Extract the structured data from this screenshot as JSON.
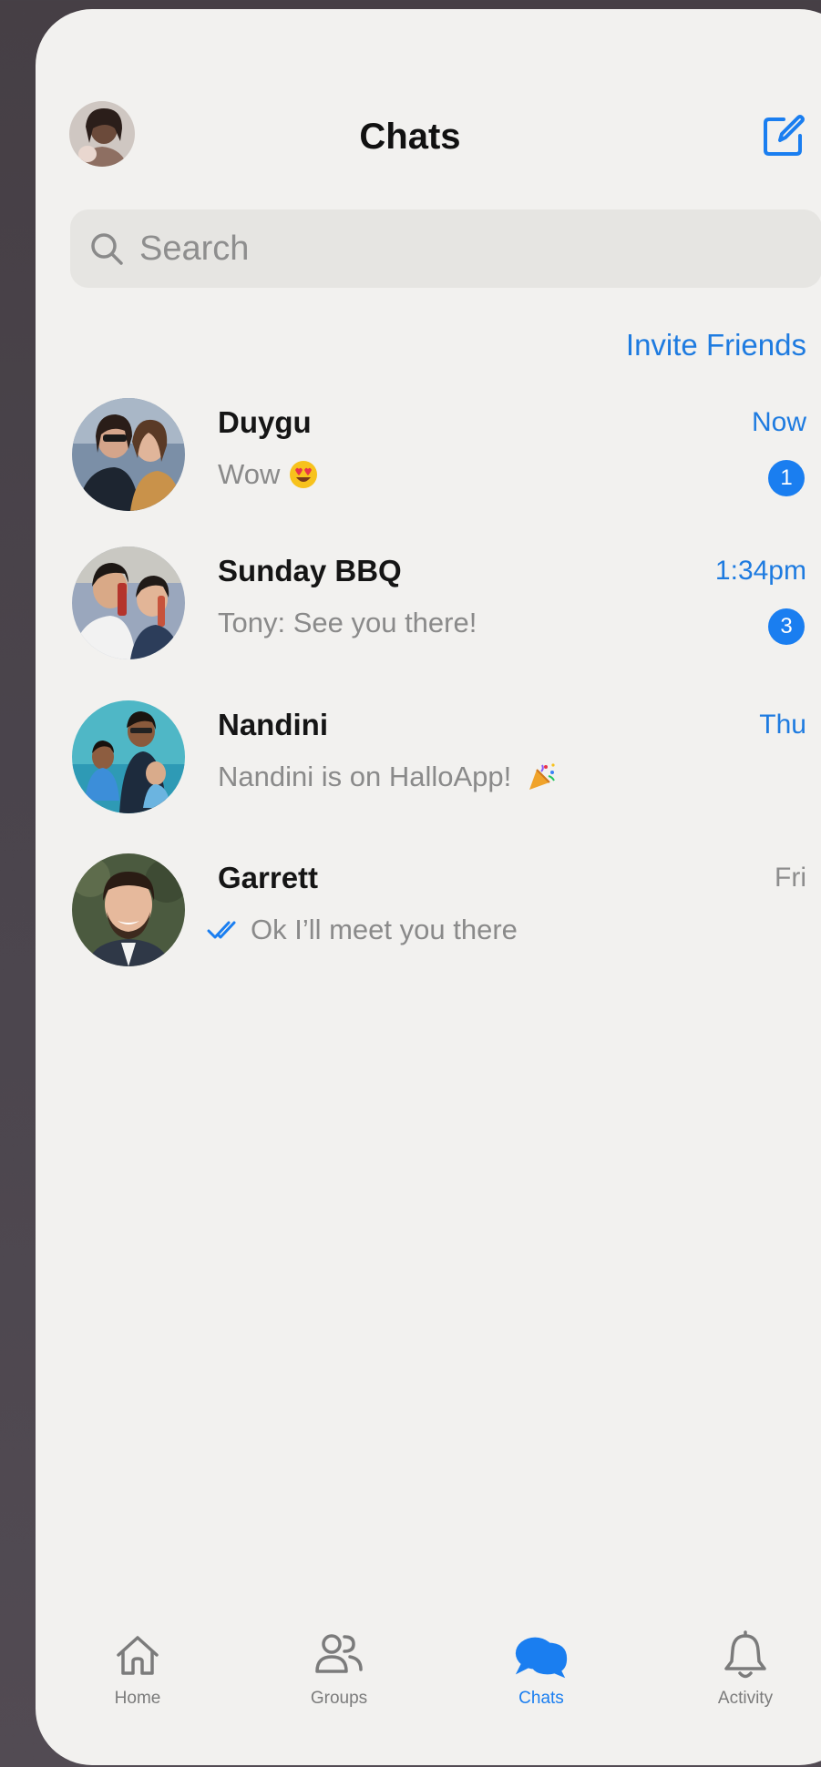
{
  "header": {
    "title": "Chats",
    "compose_icon": "compose-icon",
    "profile_icon": "avatar"
  },
  "search": {
    "placeholder": "Search",
    "value": ""
  },
  "invite_label": "Invite Friends",
  "chats": [
    {
      "name": "Duygu",
      "preview": "Wow",
      "time": "Now",
      "unread": "1",
      "emoji": "heart-eyes-emoji"
    },
    {
      "name": "Sunday BBQ",
      "preview": "Tony: See you there!",
      "time": "1:34pm",
      "unread": "3"
    },
    {
      "name": "Nandini",
      "preview": "Nandini is on HalloApp!",
      "time": "Thu",
      "emoji": "party-popper-emoji"
    },
    {
      "name": "Garrett",
      "preview": "Ok I’ll meet you there",
      "time": "Fri",
      "status_icon": "double-check-icon"
    }
  ],
  "tabs": [
    {
      "label": "Home",
      "icon": "home-icon"
    },
    {
      "label": "Groups",
      "icon": "groups-icon"
    },
    {
      "label": "Chats",
      "icon": "chats-icon",
      "active": true
    },
    {
      "label": "Activity",
      "icon": "bell-icon"
    }
  ],
  "colors": {
    "accent": "#1a7ef0",
    "link": "#1e7be0",
    "background": "#f2f1ef",
    "search_bg": "#e6e5e2",
    "muted_text": "#8a8a8a"
  }
}
